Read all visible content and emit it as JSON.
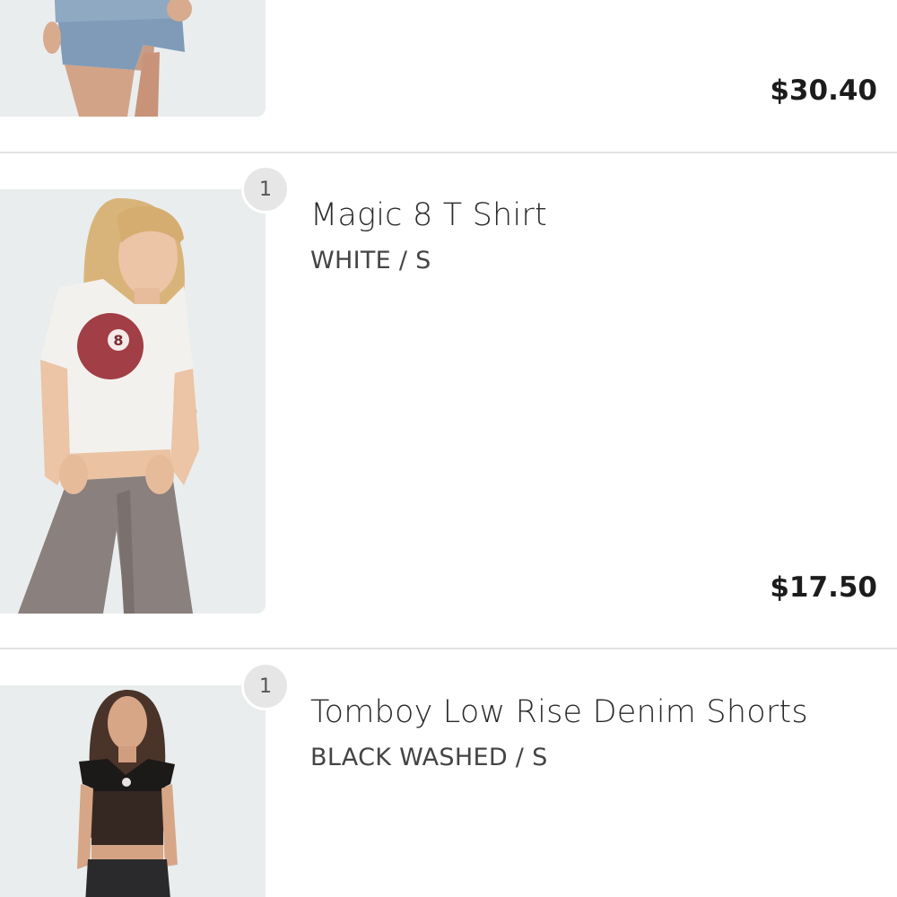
{
  "cart": {
    "items": [
      {
        "image": "denim-mini-skirt-photo",
        "price": "$30.40"
      },
      {
        "quantity": "1",
        "name": "Magic 8 T Shirt",
        "variant": "WHITE / S",
        "image": "magic-8-t-shirt-photo",
        "price": "$17.50"
      },
      {
        "quantity": "1",
        "name": "Tomboy Low Rise Denim Shorts",
        "variant": "BLACK WASHED / S",
        "image": "black-mesh-top-photo"
      }
    ]
  }
}
